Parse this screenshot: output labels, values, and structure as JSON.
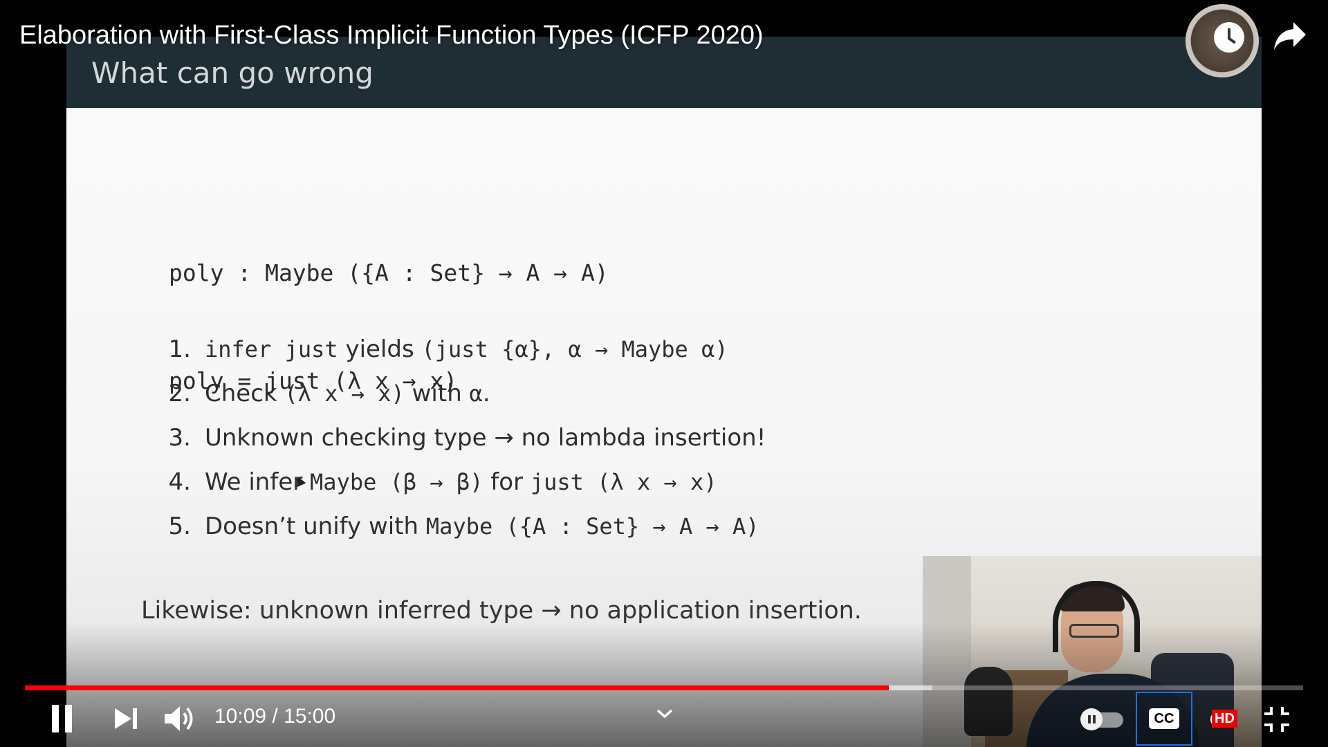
{
  "video": {
    "title": "Elaboration with First-Class Implicit Function Types (ICFP 2020)"
  },
  "slide": {
    "heading": "What can go wrong",
    "code_lines": [
      "poly : Maybe ({A : Set} → A → A)",
      "poly = just (λ x → x)"
    ],
    "steps": [
      {
        "num": "1.",
        "parts": [
          {
            "t": "infer just",
            "code": true
          },
          {
            "t": " yields ",
            "code": false
          },
          {
            "t": "(just {α}, α → Maybe α)",
            "code": true
          }
        ]
      },
      {
        "num": "2.",
        "parts": [
          {
            "t": "Check ",
            "code": false
          },
          {
            "t": "(λ x → x)",
            "code": true
          },
          {
            "t": " with ",
            "code": false
          },
          {
            "t": "α",
            "code": true
          },
          {
            "t": ".",
            "code": false
          }
        ]
      },
      {
        "num": "3.",
        "parts": [
          {
            "t": "Unknown checking type → no lambda insertion!",
            "code": false
          }
        ]
      },
      {
        "num": "4.",
        "parts": [
          {
            "t": "We infer ",
            "code": false
          },
          {
            "t": "Maybe (β → β)",
            "code": true
          },
          {
            "t": " for ",
            "code": false
          },
          {
            "t": "just (λ x → x)",
            "code": true
          }
        ]
      },
      {
        "num": "5.",
        "parts": [
          {
            "t": "Doesn’t unify with ",
            "code": false
          },
          {
            "t": "Maybe ({A : Set} → A → A)",
            "code": true
          }
        ]
      }
    ],
    "likewise": "Likewise: unknown inferred type → no application insertion."
  },
  "player": {
    "current_time": "10:09",
    "duration": "15:00",
    "time_text": "10:09 / 15:00",
    "progress_fraction": 0.676,
    "buffered_fraction": 0.71,
    "played_color": "#ff0000",
    "cc_label": "CC",
    "hd_badge": "HD",
    "autoplay_on": false
  },
  "icons": {
    "top_right": [
      "clock-icon",
      "share-icon"
    ],
    "controls": [
      "pause-icon",
      "next-icon",
      "volume-icon",
      "chevron-down-icon",
      "autoplay-toggle",
      "cc-icon",
      "settings-icon",
      "fullscreen-exit-icon"
    ]
  }
}
